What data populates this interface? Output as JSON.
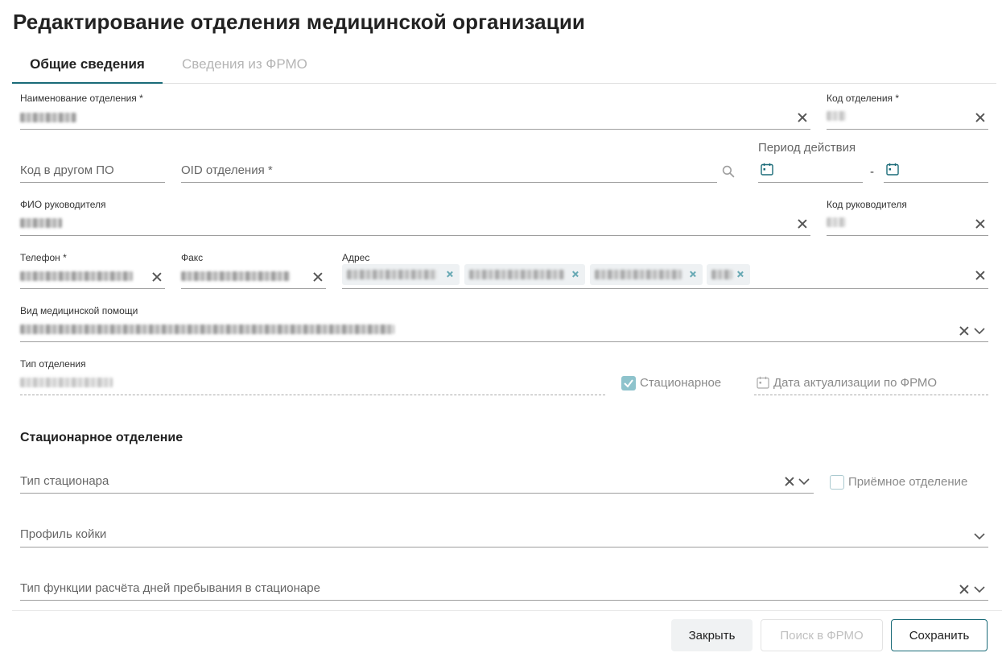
{
  "page": {
    "title": "Редактирование отделения медицинской организации"
  },
  "tabs": [
    {
      "label": "Общие сведения",
      "active": true
    },
    {
      "label": "Сведения из ФРМО",
      "active": false
    }
  ],
  "fields": {
    "dept_name": {
      "label": "Наименование отделения *"
    },
    "dept_code": {
      "label": "Код отделения *"
    },
    "other_code": {
      "placeholder": "Код в другом ПО"
    },
    "oid": {
      "placeholder": "OID отделения *"
    },
    "period": {
      "label": "Период действия",
      "separator": "-"
    },
    "head_name": {
      "label": "ФИО руководителя"
    },
    "head_code": {
      "label": "Код руководителя"
    },
    "phone": {
      "label": "Телефон *"
    },
    "fax": {
      "label": "Факс"
    },
    "address": {
      "label": "Адрес"
    },
    "care_type": {
      "label": "Вид медицинской помощи"
    },
    "dept_type": {
      "label": "Тип отделения"
    },
    "inpatient_checkbox": {
      "label": "Стационарное",
      "checked": true
    },
    "frmo_update_date": {
      "placeholder": "Дата актуализации по ФРМО"
    }
  },
  "inpatient_section": {
    "title": "Стационарное отделение",
    "hospital_type": {
      "placeholder": "Тип стационара"
    },
    "admission_checkbox": {
      "label": "Приёмное отделение",
      "checked": false
    },
    "bed_profile": {
      "placeholder": "Профиль койки"
    },
    "stay_calc_type": {
      "placeholder": "Тип функции расчёта дней пребывания в стационаре"
    }
  },
  "footer": {
    "close_label": "Закрыть",
    "frmo_search_label": "Поиск в ФРМО",
    "save_label": "Сохранить"
  },
  "colors": {
    "accent": "#1a6b78",
    "checkbox_checked": "#8ec3cc",
    "chip_bg": "#eef1f3"
  },
  "icons": [
    "close-icon",
    "search-icon",
    "calendar-icon",
    "chevron-down-icon",
    "check-icon"
  ]
}
